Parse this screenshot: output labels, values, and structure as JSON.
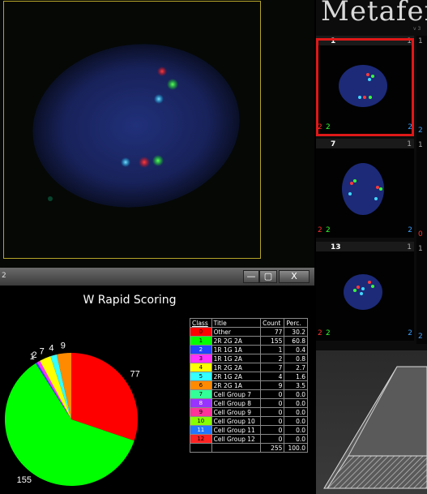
{
  "brand": {
    "title": "Metafer",
    "subtitle": "v 3"
  },
  "window": {
    "number": "2",
    "min": "—",
    "max": "▢",
    "close": "X"
  },
  "thumbnails": [
    {
      "number": "1",
      "count": "1",
      "red": "2",
      "green": "2",
      "blue": "2",
      "selected": true
    },
    {
      "number": "7",
      "count": "1",
      "red": "2",
      "green": "2",
      "blue": "2",
      "selected": false
    },
    {
      "number": "13",
      "count": "1",
      "red": "2",
      "green": "2",
      "blue": "2",
      "selected": false
    }
  ],
  "strip_values": [
    "1",
    "2",
    "1",
    "0",
    "1",
    "2"
  ],
  "chart_data": {
    "type": "pie",
    "title": "W Rapid Scoring",
    "slices": [
      {
        "label": "77",
        "value": 77,
        "color": "#ff0000"
      },
      {
        "label": "155",
        "value": 155,
        "color": "#00ff00"
      },
      {
        "label": "1",
        "value": 1,
        "color": "#4444ff"
      },
      {
        "label": "2",
        "value": 2,
        "color": "#ff33ff"
      },
      {
        "label": "7",
        "value": 7,
        "color": "#ffff00"
      },
      {
        "label": "4",
        "value": 4,
        "color": "#33ffff"
      },
      {
        "label": "9",
        "value": 9,
        "color": "#ff8a00"
      }
    ]
  },
  "legend": {
    "headers": [
      "Class",
      "Title",
      "Count",
      "Perc."
    ],
    "rows": [
      {
        "class": "0",
        "title": "Other",
        "count": "77",
        "perc": "30.2",
        "color": "#ff0000"
      },
      {
        "class": "1",
        "title": "2R 2G 2A",
        "count": "155",
        "perc": "60.8",
        "color": "#00ff00"
      },
      {
        "class": "2",
        "title": "1R 1G 1A",
        "count": "1",
        "perc": "0.4",
        "color": "#2244ff"
      },
      {
        "class": "3",
        "title": "1R 1G 2A",
        "count": "2",
        "perc": "0.8",
        "color": "#ff33ff"
      },
      {
        "class": "4",
        "title": "1R 2G 2A",
        "count": "7",
        "perc": "2.7",
        "color": "#ffff00"
      },
      {
        "class": "5",
        "title": "2R 1G 2A",
        "count": "4",
        "perc": "1.6",
        "color": "#33ffff"
      },
      {
        "class": "6",
        "title": "2R 2G 1A",
        "count": "9",
        "perc": "3.5",
        "color": "#ff8a00"
      },
      {
        "class": "7",
        "title": "Cell Group 7",
        "count": "0",
        "perc": "0.0",
        "color": "#33ff99"
      },
      {
        "class": "8",
        "title": "Cell Group 8",
        "count": "0",
        "perc": "0.0",
        "color": "#9933ff"
      },
      {
        "class": "9",
        "title": "Cell Group 9",
        "count": "0",
        "perc": "0.0",
        "color": "#ff3399"
      },
      {
        "class": "10",
        "title": "Cell Group 10",
        "count": "0",
        "perc": "0.0",
        "color": "#88ff00"
      },
      {
        "class": "11",
        "title": "Cell Group 11",
        "count": "0",
        "perc": "0.0",
        "color": "#2277ff"
      },
      {
        "class": "12",
        "title": "Cell Group 12",
        "count": "0",
        "perc": "0.0",
        "color": "#ff2222"
      }
    ],
    "total_count": "255",
    "total_perc": "100.0"
  }
}
